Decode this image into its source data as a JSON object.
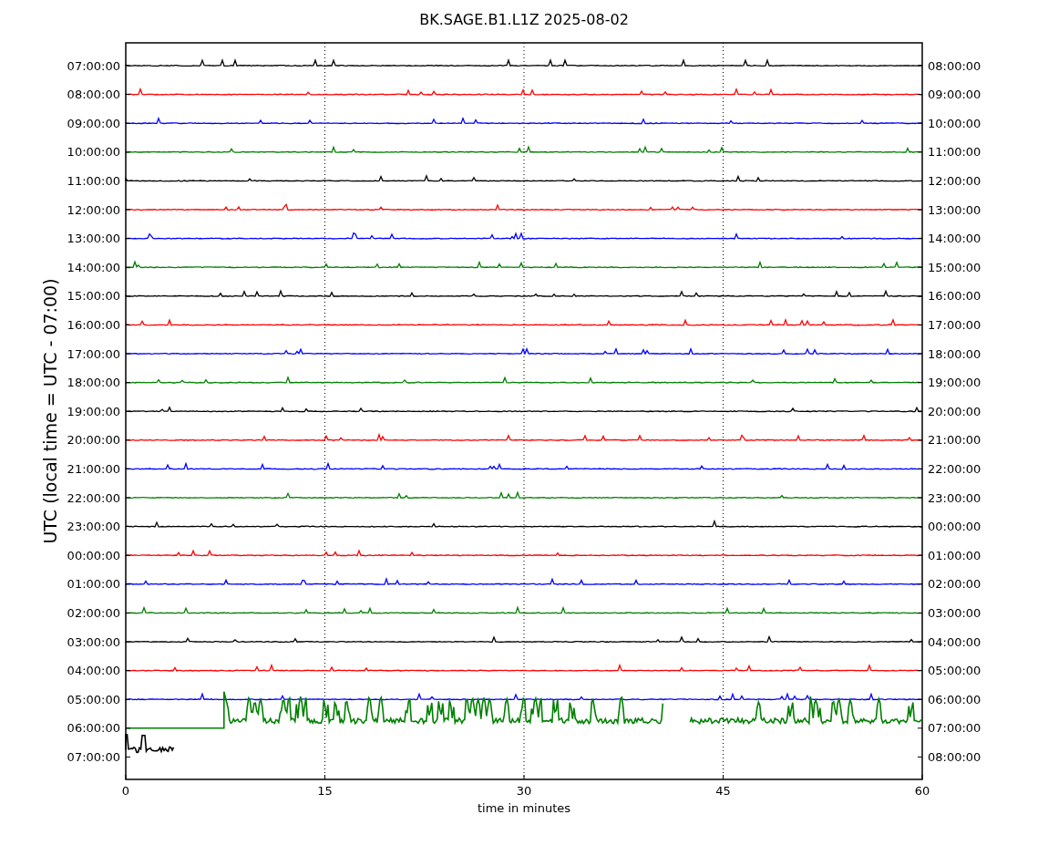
{
  "title": "BK.SAGE.B1.L1Z 2025-08-02",
  "ylabel": "UTC (local time = UTC - 07:00)",
  "xlabel": "time in minutes",
  "xticks": [
    "0",
    "15",
    "30",
    "45",
    "60"
  ],
  "rows": [
    {
      "left": "07:00:00",
      "right": "08:00:00",
      "color": "#000000",
      "kind": "quiet"
    },
    {
      "left": "08:00:00",
      "right": "09:00:00",
      "color": "#ff0000",
      "kind": "quiet"
    },
    {
      "left": "09:00:00",
      "right": "10:00:00",
      "color": "#0000ff",
      "kind": "quiet"
    },
    {
      "left": "10:00:00",
      "right": "11:00:00",
      "color": "#008000",
      "kind": "quiet"
    },
    {
      "left": "11:00:00",
      "right": "12:00:00",
      "color": "#000000",
      "kind": "quiet"
    },
    {
      "left": "12:00:00",
      "right": "13:00:00",
      "color": "#ff0000",
      "kind": "quiet"
    },
    {
      "left": "13:00:00",
      "right": "14:00:00",
      "color": "#0000ff",
      "kind": "quiet"
    },
    {
      "left": "14:00:00",
      "right": "15:00:00",
      "color": "#008000",
      "kind": "quiet"
    },
    {
      "left": "15:00:00",
      "right": "16:00:00",
      "color": "#000000",
      "kind": "quiet"
    },
    {
      "left": "16:00:00",
      "right": "17:00:00",
      "color": "#ff0000",
      "kind": "quiet"
    },
    {
      "left": "17:00:00",
      "right": "18:00:00",
      "color": "#0000ff",
      "kind": "quiet"
    },
    {
      "left": "18:00:00",
      "right": "19:00:00",
      "color": "#008000",
      "kind": "quiet"
    },
    {
      "left": "19:00:00",
      "right": "20:00:00",
      "color": "#000000",
      "kind": "quiet"
    },
    {
      "left": "20:00:00",
      "right": "21:00:00",
      "color": "#ff0000",
      "kind": "quiet"
    },
    {
      "left": "21:00:00",
      "right": "22:00:00",
      "color": "#0000ff",
      "kind": "quiet"
    },
    {
      "left": "22:00:00",
      "right": "23:00:00",
      "color": "#008000",
      "kind": "quiet"
    },
    {
      "left": "23:00:00",
      "right": "00:00:00",
      "color": "#000000",
      "kind": "quiet"
    },
    {
      "left": "00:00:00",
      "right": "01:00:00",
      "color": "#ff0000",
      "kind": "quiet"
    },
    {
      "left": "01:00:00",
      "right": "02:00:00",
      "color": "#0000ff",
      "kind": "quiet"
    },
    {
      "left": "02:00:00",
      "right": "03:00:00",
      "color": "#008000",
      "kind": "quiet"
    },
    {
      "left": "03:00:00",
      "right": "04:00:00",
      "color": "#000000",
      "kind": "quiet"
    },
    {
      "left": "04:00:00",
      "right": "05:00:00",
      "color": "#ff0000",
      "kind": "quiet"
    },
    {
      "left": "05:00:00",
      "right": "06:00:00",
      "color": "#0000ff",
      "kind": "quiet"
    },
    {
      "left": "06:00:00",
      "right": "07:00:00",
      "color": "#008000",
      "kind": "active"
    },
    {
      "left": "07:00:00",
      "right": "08:00:00",
      "color": "#000000",
      "kind": "partial"
    }
  ]
}
